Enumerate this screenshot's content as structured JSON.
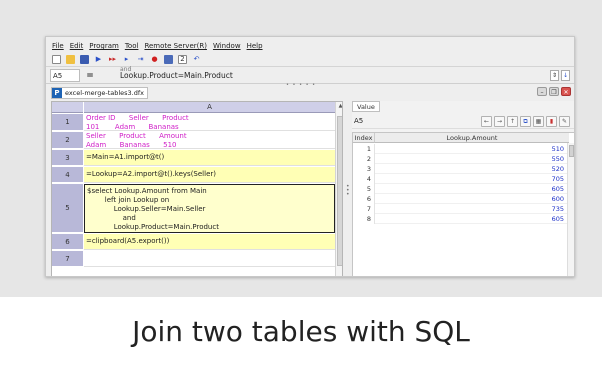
{
  "menu": [
    "File",
    "Edit",
    "Program",
    "Tool",
    "Remote Server(R)",
    "Window",
    "Help"
  ],
  "toolbar_icons": [
    "new-file-icon",
    "open-folder-icon",
    "save-icon",
    "run-icon",
    "step-icon",
    "step-over-icon",
    "stop-icon",
    "breakpoint-icon",
    "calc-icon",
    "clear-icon",
    "undo-icon"
  ],
  "formula_bar": {
    "cell_ref": "A5",
    "eq": "=",
    "prev_line": "and",
    "text": "Lookup.Product=Main.Product"
  },
  "tab": {
    "icon_letter": "P",
    "filename": "excel-merge-tables3.dfx"
  },
  "grid": {
    "column_header": "A",
    "rows": [
      {
        "num": "1",
        "lines": [
          "Order ID      Seller      Product",
          "101       Adam      Bananas"
        ],
        "style": "magenta"
      },
      {
        "num": "2",
        "lines": [
          "Seller      Product      Amount",
          "Adam      Bananas      510"
        ],
        "style": "magenta"
      },
      {
        "num": "3",
        "lines": [
          "=Main=A1.import@t()"
        ],
        "style": "yellow"
      },
      {
        "num": "4",
        "lines": [
          "=Lookup=A2.import@t().keys(Seller)"
        ],
        "style": "yellow"
      },
      {
        "num": "5",
        "lines": [
          "$select Lookup.Amount from Main",
          "        left join Lookup on",
          "            Lookup.Seller=Main.Seller",
          "                and",
          "            Lookup.Product=Main.Product"
        ],
        "style": "selected"
      },
      {
        "num": "6",
        "lines": [
          "=clipboard(A5.export())"
        ],
        "style": "yellow"
      },
      {
        "num": "7",
        "lines": [
          ""
        ],
        "style": "plain"
      }
    ]
  },
  "value_panel": {
    "tab": "Value",
    "cell_ref": "A5",
    "headers": [
      "Index",
      "Lookup.Amount"
    ],
    "rows": [
      {
        "index": "1",
        "value": "510"
      },
      {
        "index": "2",
        "value": "550"
      },
      {
        "index": "3",
        "value": "520"
      },
      {
        "index": "4",
        "value": "705"
      },
      {
        "index": "5",
        "value": "605"
      },
      {
        "index": "6",
        "value": "600"
      },
      {
        "index": "7",
        "value": "735"
      },
      {
        "index": "8",
        "value": "605"
      }
    ]
  },
  "caption": "Join two tables with SQL"
}
